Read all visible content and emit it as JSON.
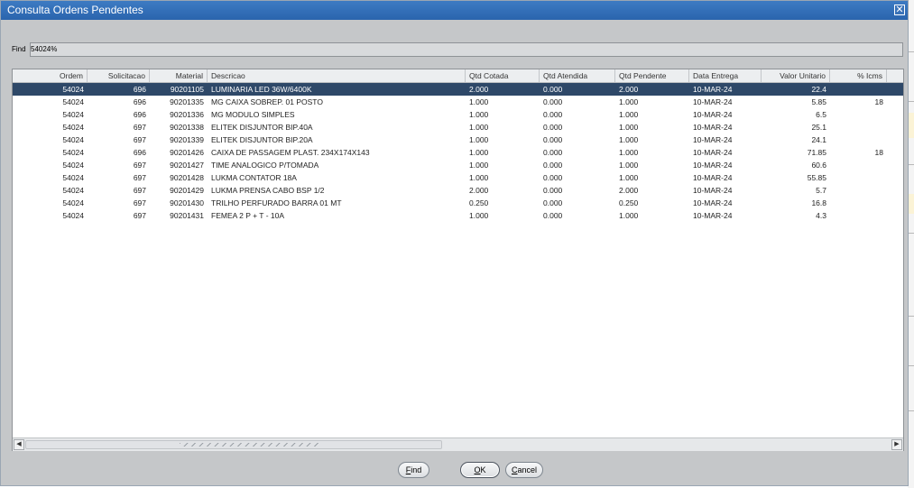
{
  "dialog": {
    "title": "Consulta Ordens Pendentes",
    "close_glyph": "✕"
  },
  "find": {
    "label": "Find",
    "value": "54024%"
  },
  "grid": {
    "columns": [
      {
        "key": "ordem",
        "label": "Ordem"
      },
      {
        "key": "solicitacao",
        "label": "Solicitacao"
      },
      {
        "key": "material",
        "label": "Material"
      },
      {
        "key": "descricao",
        "label": "Descricao"
      },
      {
        "key": "qtd_cotada",
        "label": "Qtd Cotada"
      },
      {
        "key": "qtd_atendida",
        "label": "Qtd Atendida"
      },
      {
        "key": "qtd_pendente",
        "label": "Qtd Pendente"
      },
      {
        "key": "data_entrega",
        "label": "Data Entrega"
      },
      {
        "key": "valor_unitario",
        "label": "Valor Unitario"
      },
      {
        "key": "icms",
        "label": "% Icms"
      }
    ],
    "selected_row": 0,
    "rows": [
      [
        "54024",
        "696",
        "90201105",
        "LUMINARIA LED 36W/6400K",
        "2.000",
        "0.000",
        "2.000",
        "10-MAR-24",
        "22.4",
        ""
      ],
      [
        "54024",
        "696",
        "90201335",
        "MG CAIXA SOBREP. 01 POSTO",
        "1.000",
        "0.000",
        "1.000",
        "10-MAR-24",
        "5.85",
        "18"
      ],
      [
        "54024",
        "696",
        "90201336",
        "MG MODULO SIMPLES",
        "1.000",
        "0.000",
        "1.000",
        "10-MAR-24",
        "6.5",
        ""
      ],
      [
        "54024",
        "697",
        "90201338",
        "ELITEK DISJUNTOR BIP.40A",
        "1.000",
        "0.000",
        "1.000",
        "10-MAR-24",
        "25.1",
        ""
      ],
      [
        "54024",
        "697",
        "90201339",
        "ELITEK DISJUNTOR BIP.20A",
        "1.000",
        "0.000",
        "1.000",
        "10-MAR-24",
        "24.1",
        ""
      ],
      [
        "54024",
        "696",
        "90201426",
        "CAIXA DE PASSAGEM PLAST. 234X174X143",
        "1.000",
        "0.000",
        "1.000",
        "10-MAR-24",
        "71.85",
        "18"
      ],
      [
        "54024",
        "697",
        "90201427",
        "TIME ANALOGICO P/TOMADA",
        "1.000",
        "0.000",
        "1.000",
        "10-MAR-24",
        "60.6",
        ""
      ],
      [
        "54024",
        "697",
        "90201428",
        "LUKMA CONTATOR 18A",
        "1.000",
        "0.000",
        "1.000",
        "10-MAR-24",
        "55.85",
        ""
      ],
      [
        "54024",
        "697",
        "90201429",
        "LUKMA PRENSA CABO BSP 1/2",
        "2.000",
        "0.000",
        "2.000",
        "10-MAR-24",
        "5.7",
        ""
      ],
      [
        "54024",
        "697",
        "90201430",
        "TRILHO PERFURADO BARRA 01 MT",
        "0.250",
        "0.000",
        "0.250",
        "10-MAR-24",
        "16.8",
        ""
      ],
      [
        "54024",
        "697",
        "90201431",
        "FEMEA 2 P + T - 10A",
        "1.000",
        "0.000",
        "1.000",
        "10-MAR-24",
        "4.3",
        ""
      ]
    ]
  },
  "scrollbar": {
    "left_glyph": "◀",
    "right_glyph": "▶"
  },
  "buttons": {
    "find": {
      "hotkey": "F",
      "rest": "ind"
    },
    "ok": {
      "hotkey": "O",
      "rest": "K"
    },
    "cancel": {
      "hotkey": "C",
      "rest": "ancel"
    }
  }
}
